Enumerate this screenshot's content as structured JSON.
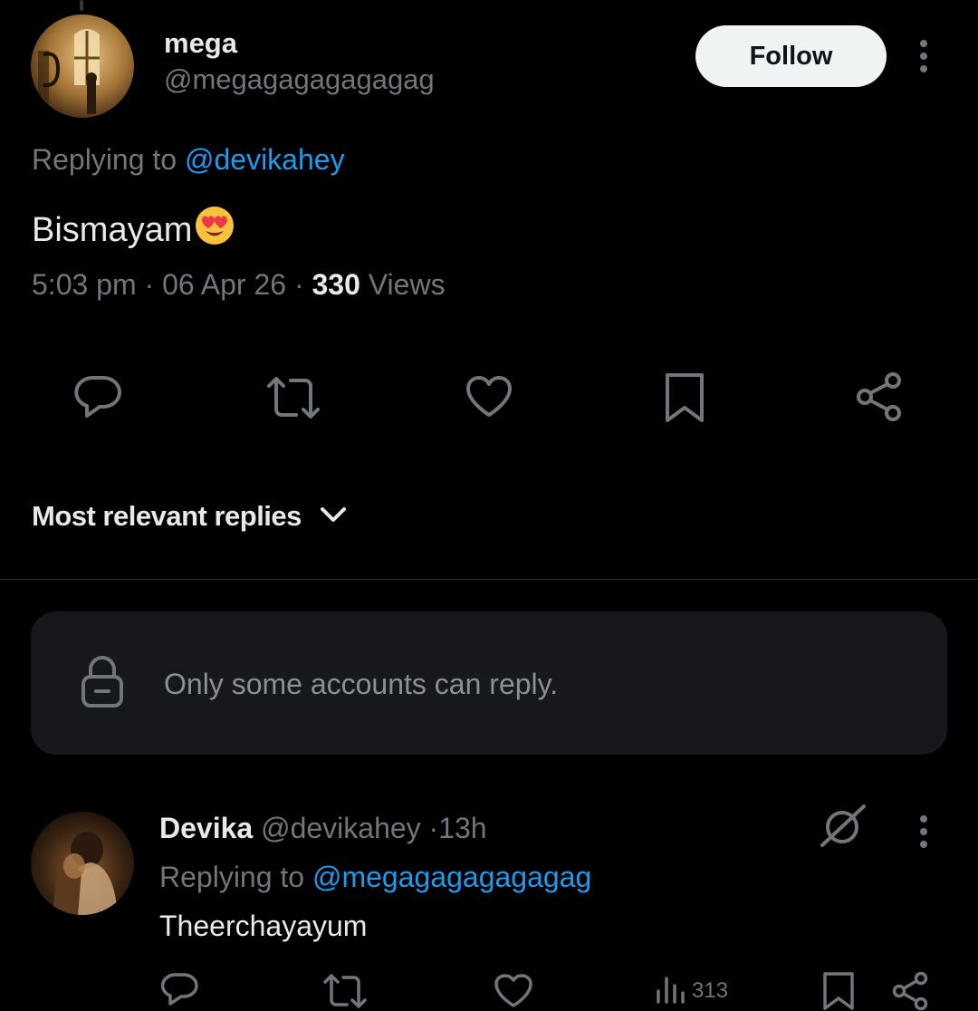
{
  "main_tweet": {
    "display_name": "mega",
    "handle": "@megagagagagagag",
    "follow_label": "Follow",
    "replying_prefix": "Replying to ",
    "replying_handle": "@devikahey",
    "text": "Bismayam",
    "emoji": "heart-eyes-emoji",
    "time": "5:03 pm",
    "separator": "·",
    "date": "06 Apr 26",
    "views_count": "330",
    "views_label": "Views",
    "actions": [
      "reply-icon",
      "retweet-icon",
      "like-icon",
      "bookmark-icon",
      "share-icon"
    ]
  },
  "sort": {
    "label": "Most relevant replies"
  },
  "reply_restriction": {
    "icon": "lock-icon",
    "text": "Only some accounts can reply."
  },
  "reply": {
    "display_name": "Devika",
    "handle": "@devikahey",
    "separator": "·",
    "age": "13h",
    "replying_prefix": "Replying to ",
    "replying_handle": "@megagagagagagag",
    "text": "Theerchayayum",
    "views_count": "313",
    "actions": [
      "reply-icon",
      "retweet-icon",
      "like-icon",
      "views-icon",
      "bookmark-icon",
      "share-icon"
    ]
  },
  "colors": {
    "background": "#000000",
    "text": "#e7e9ea",
    "muted": "#71767b",
    "link": "#1d9bf0",
    "card": "#16181c",
    "follow_button": "#eff3f4"
  }
}
